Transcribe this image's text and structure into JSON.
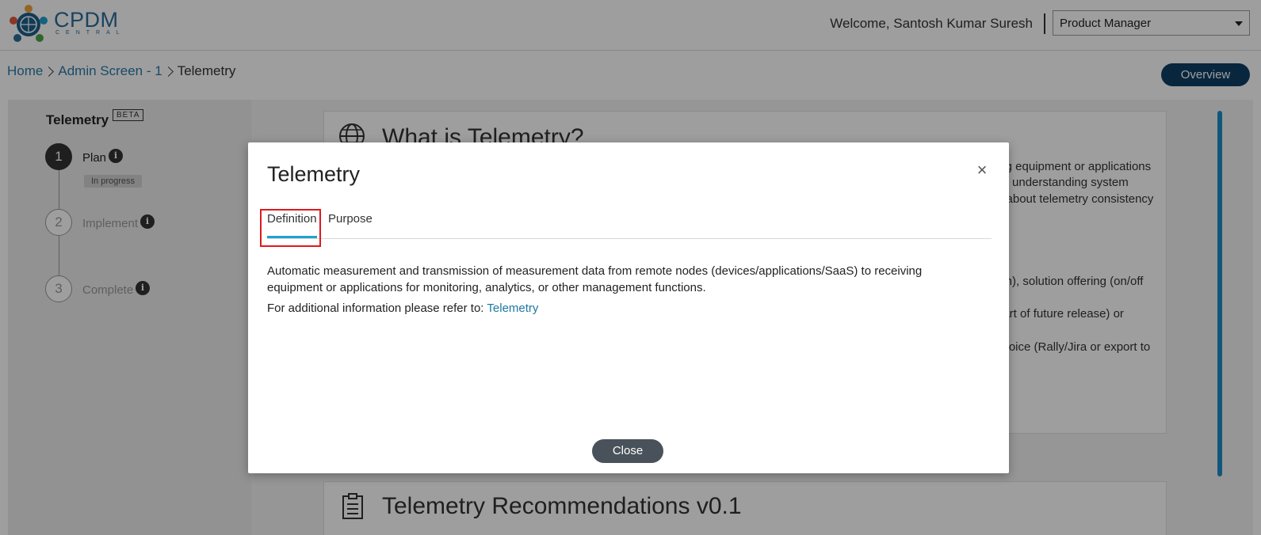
{
  "header": {
    "logo_text": "CPDM",
    "logo_subtext": "CENTRAL",
    "welcome": "Welcome, Santosh Kumar Suresh",
    "role_select": {
      "value": "Product Manager",
      "icon": "chevron-down-icon"
    }
  },
  "breadcrumb": {
    "items": [
      "Home",
      "Admin Screen - 1",
      "Telemetry"
    ]
  },
  "overview_button": "Overview",
  "sidebar": {
    "title": "Telemetry",
    "beta": "BETA",
    "steps": [
      {
        "number": "1",
        "label": "Plan",
        "status": "In progress",
        "active": true
      },
      {
        "number": "2",
        "label": "Implement",
        "active": false
      },
      {
        "number": "3",
        "label": "Complete",
        "active": false
      }
    ]
  },
  "background": {
    "card1_title": "What is Telemetry?",
    "card1_lines": [
      "ing equipment or applications",
      "as understanding system",
      "g about telemetry consistency",
      "ion), solution offering (on/off",
      "part of future release) or",
      "choice (Rally/Jira or export to"
    ],
    "card2_title": "Telemetry Recommendations v0.1"
  },
  "modal": {
    "title": "Telemetry",
    "tabs": [
      "Definition",
      "Purpose"
    ],
    "active_tab": "Definition",
    "body": "Automatic measurement and transmission of measurement data from remote nodes (devices/applications/SaaS) to receiving equipment or applications for monitoring, analytics, or other management functions.",
    "ref_prefix": "For additional information please refer to:",
    "ref_link": "Telemetry",
    "close_label": "Close"
  },
  "colors": {
    "brand_dark": "#0d3f66",
    "link": "#1d77a5",
    "tab_underline": "#1ea2cf",
    "highlight": "#e0191d"
  }
}
